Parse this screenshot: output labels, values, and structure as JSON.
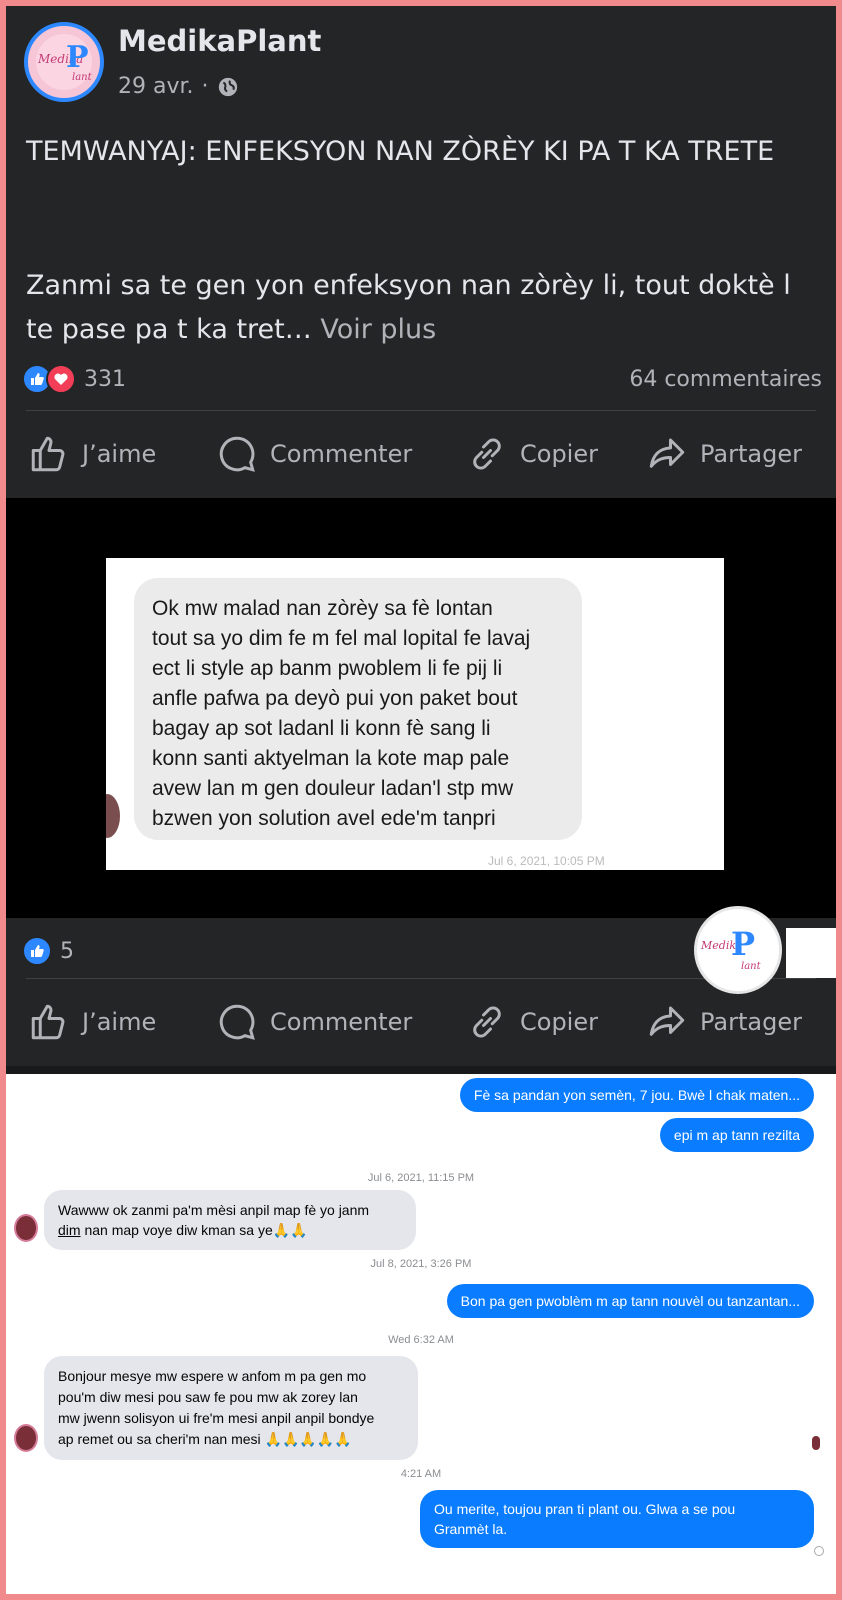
{
  "post": {
    "page_name": "MedikaPlant",
    "date": "29 avr.",
    "date_separator": "·",
    "privacy_icon": "globe-icon",
    "title": "TEMWANYAJ: ENFEKSYON NAN ZÒRÈY KI PA T KA TRETE",
    "body": "Zanmi sa te gen yon enfeksyon nan zòrèy li, tout doktè l te pase pa t ka tret…",
    "see_more": "Voir plus",
    "reaction_count": "331",
    "comments": "64 commentaires",
    "actions": {
      "like": "J’aime",
      "comment": "Commenter",
      "copy": "Copier",
      "share": "Partager"
    }
  },
  "logo": {
    "word": "Medika",
    "p": "P",
    "word2": "lant"
  },
  "photo_post": {
    "message": "Ok mw malad nan zòrèy sa fè lontan tout sa yo dim fe m fel mal lopital fe lavaj ect li style ap banm pwoblem li fe pij li anfle pafwa pa deyò pui yon paket bout bagay ap sot ladanl li konn fè sang li konn santi aktyelman la kote map pale avew lan m gen douleur ladan'l stp mw bzwen yon solution avel ede'm  tanpri",
    "message_lines": [
      "Ok mw malad nan zòrèy sa fè lontan",
      "tout sa yo dim fe m fel mal lopital fe lavaj",
      "ect li style ap banm pwoblem li fe pij li",
      "anfle pafwa pa deyò pui yon paket bout",
      "bagay ap sot ladanl li konn fè sang li",
      "konn santi aktyelman la kote map pale",
      "avew lan m gen douleur ladan'l stp mw",
      "bzwen yon solution avel ede'm  tanpri"
    ],
    "timestamp_partial": "Jul 6, 2021, 10:05 PM",
    "reaction_count": "5",
    "actions": {
      "like": "J’aime",
      "comment": "Commenter",
      "copy": "Copier",
      "share": "Partager"
    }
  },
  "chat": {
    "out1": "Fè sa pandan yon semèn, 7 jou. Bwè l chak maten...",
    "out2": "epi m ap tann rezilta",
    "stamp1": "Jul 6, 2021, 11:15 PM",
    "in1_line1": "Wawww ok zanmi pa'm mèsi anpil map fè yo janm",
    "in1_line2_u": "dim",
    "in1_line2_rest": " nan map voye diw kman sa ye🙏🙏",
    "stamp2": "Jul 8, 2021, 3:26 PM",
    "out3": "Bon pa gen pwoblèm m ap tann nouvèl ou tanzantan...",
    "stamp3": "Wed 6:32 AM",
    "in2_lines": [
      "Bonjour mesye mw espere w anfom m pa gen mo",
      "pou'm diw mesi pou saw fe pou mw ak zorey lan",
      "mw jwenn solisyon ui fre'm mesi anpil anpil bondye",
      "ap remet ou sa cheri'm nan mesi 🙏🙏🙏🙏🙏"
    ],
    "stamp4": "4:21 AM",
    "out4_lines": [
      "Ou merite, toujou pran ti plant ou. Glwa a se pou",
      "Granmèt la."
    ]
  },
  "colors": {
    "border": "#f08a8c",
    "facebook_dark": "#242526",
    "like_blue": "#2d88ff",
    "love_red": "#f33e58",
    "messenger_blue": "#0a7cff"
  }
}
